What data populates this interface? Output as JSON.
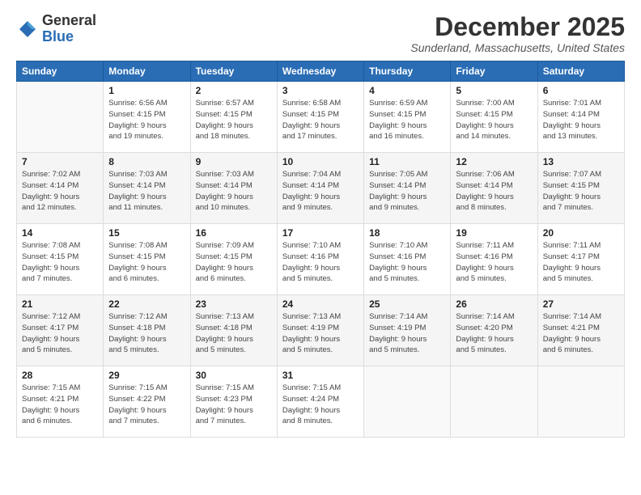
{
  "logo": {
    "general": "General",
    "blue": "Blue"
  },
  "title": "December 2025",
  "location": "Sunderland, Massachusetts, United States",
  "header_days": [
    "Sunday",
    "Monday",
    "Tuesday",
    "Wednesday",
    "Thursday",
    "Friday",
    "Saturday"
  ],
  "weeks": [
    [
      {
        "day": "",
        "info": ""
      },
      {
        "day": "1",
        "info": "Sunrise: 6:56 AM\nSunset: 4:15 PM\nDaylight: 9 hours\nand 19 minutes."
      },
      {
        "day": "2",
        "info": "Sunrise: 6:57 AM\nSunset: 4:15 PM\nDaylight: 9 hours\nand 18 minutes."
      },
      {
        "day": "3",
        "info": "Sunrise: 6:58 AM\nSunset: 4:15 PM\nDaylight: 9 hours\nand 17 minutes."
      },
      {
        "day": "4",
        "info": "Sunrise: 6:59 AM\nSunset: 4:15 PM\nDaylight: 9 hours\nand 16 minutes."
      },
      {
        "day": "5",
        "info": "Sunrise: 7:00 AM\nSunset: 4:15 PM\nDaylight: 9 hours\nand 14 minutes."
      },
      {
        "day": "6",
        "info": "Sunrise: 7:01 AM\nSunset: 4:14 PM\nDaylight: 9 hours\nand 13 minutes."
      }
    ],
    [
      {
        "day": "7",
        "info": "Sunrise: 7:02 AM\nSunset: 4:14 PM\nDaylight: 9 hours\nand 12 minutes."
      },
      {
        "day": "8",
        "info": "Sunrise: 7:03 AM\nSunset: 4:14 PM\nDaylight: 9 hours\nand 11 minutes."
      },
      {
        "day": "9",
        "info": "Sunrise: 7:03 AM\nSunset: 4:14 PM\nDaylight: 9 hours\nand 10 minutes."
      },
      {
        "day": "10",
        "info": "Sunrise: 7:04 AM\nSunset: 4:14 PM\nDaylight: 9 hours\nand 9 minutes."
      },
      {
        "day": "11",
        "info": "Sunrise: 7:05 AM\nSunset: 4:14 PM\nDaylight: 9 hours\nand 9 minutes."
      },
      {
        "day": "12",
        "info": "Sunrise: 7:06 AM\nSunset: 4:14 PM\nDaylight: 9 hours\nand 8 minutes."
      },
      {
        "day": "13",
        "info": "Sunrise: 7:07 AM\nSunset: 4:15 PM\nDaylight: 9 hours\nand 7 minutes."
      }
    ],
    [
      {
        "day": "14",
        "info": "Sunrise: 7:08 AM\nSunset: 4:15 PM\nDaylight: 9 hours\nand 7 minutes."
      },
      {
        "day": "15",
        "info": "Sunrise: 7:08 AM\nSunset: 4:15 PM\nDaylight: 9 hours\nand 6 minutes."
      },
      {
        "day": "16",
        "info": "Sunrise: 7:09 AM\nSunset: 4:15 PM\nDaylight: 9 hours\nand 6 minutes."
      },
      {
        "day": "17",
        "info": "Sunrise: 7:10 AM\nSunset: 4:16 PM\nDaylight: 9 hours\nand 5 minutes."
      },
      {
        "day": "18",
        "info": "Sunrise: 7:10 AM\nSunset: 4:16 PM\nDaylight: 9 hours\nand 5 minutes."
      },
      {
        "day": "19",
        "info": "Sunrise: 7:11 AM\nSunset: 4:16 PM\nDaylight: 9 hours\nand 5 minutes."
      },
      {
        "day": "20",
        "info": "Sunrise: 7:11 AM\nSunset: 4:17 PM\nDaylight: 9 hours\nand 5 minutes."
      }
    ],
    [
      {
        "day": "21",
        "info": "Sunrise: 7:12 AM\nSunset: 4:17 PM\nDaylight: 9 hours\nand 5 minutes."
      },
      {
        "day": "22",
        "info": "Sunrise: 7:12 AM\nSunset: 4:18 PM\nDaylight: 9 hours\nand 5 minutes."
      },
      {
        "day": "23",
        "info": "Sunrise: 7:13 AM\nSunset: 4:18 PM\nDaylight: 9 hours\nand 5 minutes."
      },
      {
        "day": "24",
        "info": "Sunrise: 7:13 AM\nSunset: 4:19 PM\nDaylight: 9 hours\nand 5 minutes."
      },
      {
        "day": "25",
        "info": "Sunrise: 7:14 AM\nSunset: 4:19 PM\nDaylight: 9 hours\nand 5 minutes."
      },
      {
        "day": "26",
        "info": "Sunrise: 7:14 AM\nSunset: 4:20 PM\nDaylight: 9 hours\nand 5 minutes."
      },
      {
        "day": "27",
        "info": "Sunrise: 7:14 AM\nSunset: 4:21 PM\nDaylight: 9 hours\nand 6 minutes."
      }
    ],
    [
      {
        "day": "28",
        "info": "Sunrise: 7:15 AM\nSunset: 4:21 PM\nDaylight: 9 hours\nand 6 minutes."
      },
      {
        "day": "29",
        "info": "Sunrise: 7:15 AM\nSunset: 4:22 PM\nDaylight: 9 hours\nand 7 minutes."
      },
      {
        "day": "30",
        "info": "Sunrise: 7:15 AM\nSunset: 4:23 PM\nDaylight: 9 hours\nand 7 minutes."
      },
      {
        "day": "31",
        "info": "Sunrise: 7:15 AM\nSunset: 4:24 PM\nDaylight: 9 hours\nand 8 minutes."
      },
      {
        "day": "",
        "info": ""
      },
      {
        "day": "",
        "info": ""
      },
      {
        "day": "",
        "info": ""
      }
    ]
  ]
}
